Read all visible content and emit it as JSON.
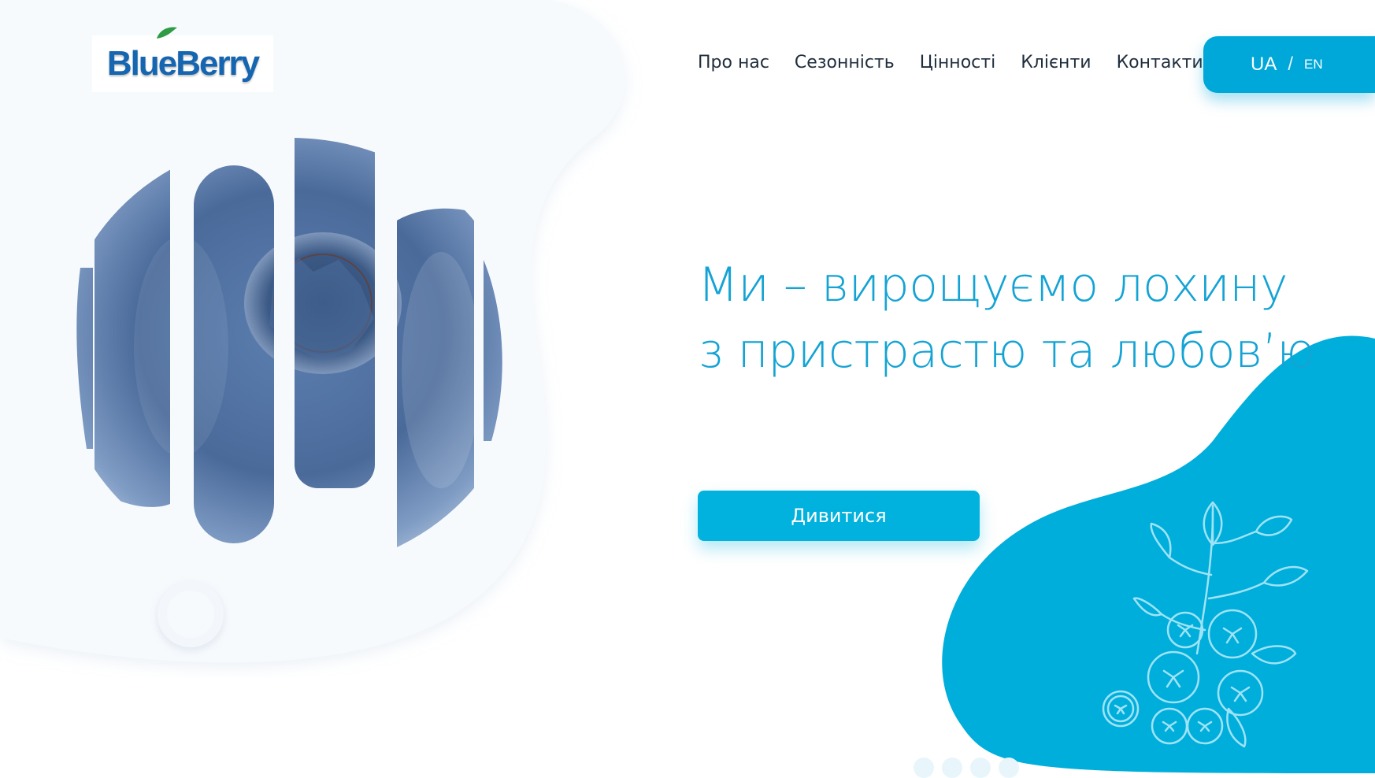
{
  "brand": {
    "logo_text": "BlueBerry",
    "logo_color": "#1565b0",
    "leaf_color": "#2e9b45"
  },
  "nav": {
    "items": [
      "Про нас",
      "Сезонність",
      "Цінності",
      "Клієнти",
      "Контакти"
    ]
  },
  "language": {
    "active": "UA",
    "separator": "/",
    "other": "EN"
  },
  "hero": {
    "title_line1": "Ми – вирощуємо лохину",
    "title_line2": "з пристрастю та любов’ю",
    "cta_label": "Дивитися"
  },
  "colors": {
    "accent": "#00a7d9",
    "headline": "#14a3d4",
    "blob_right": "#00aedb",
    "blob_left": "#f7fafd",
    "berry_dark": "#3e5f8e",
    "berry_light": "#a8bcd6"
  },
  "icons": {
    "pager": "ring-icon",
    "illustration": "blueberry-branch-icon"
  }
}
